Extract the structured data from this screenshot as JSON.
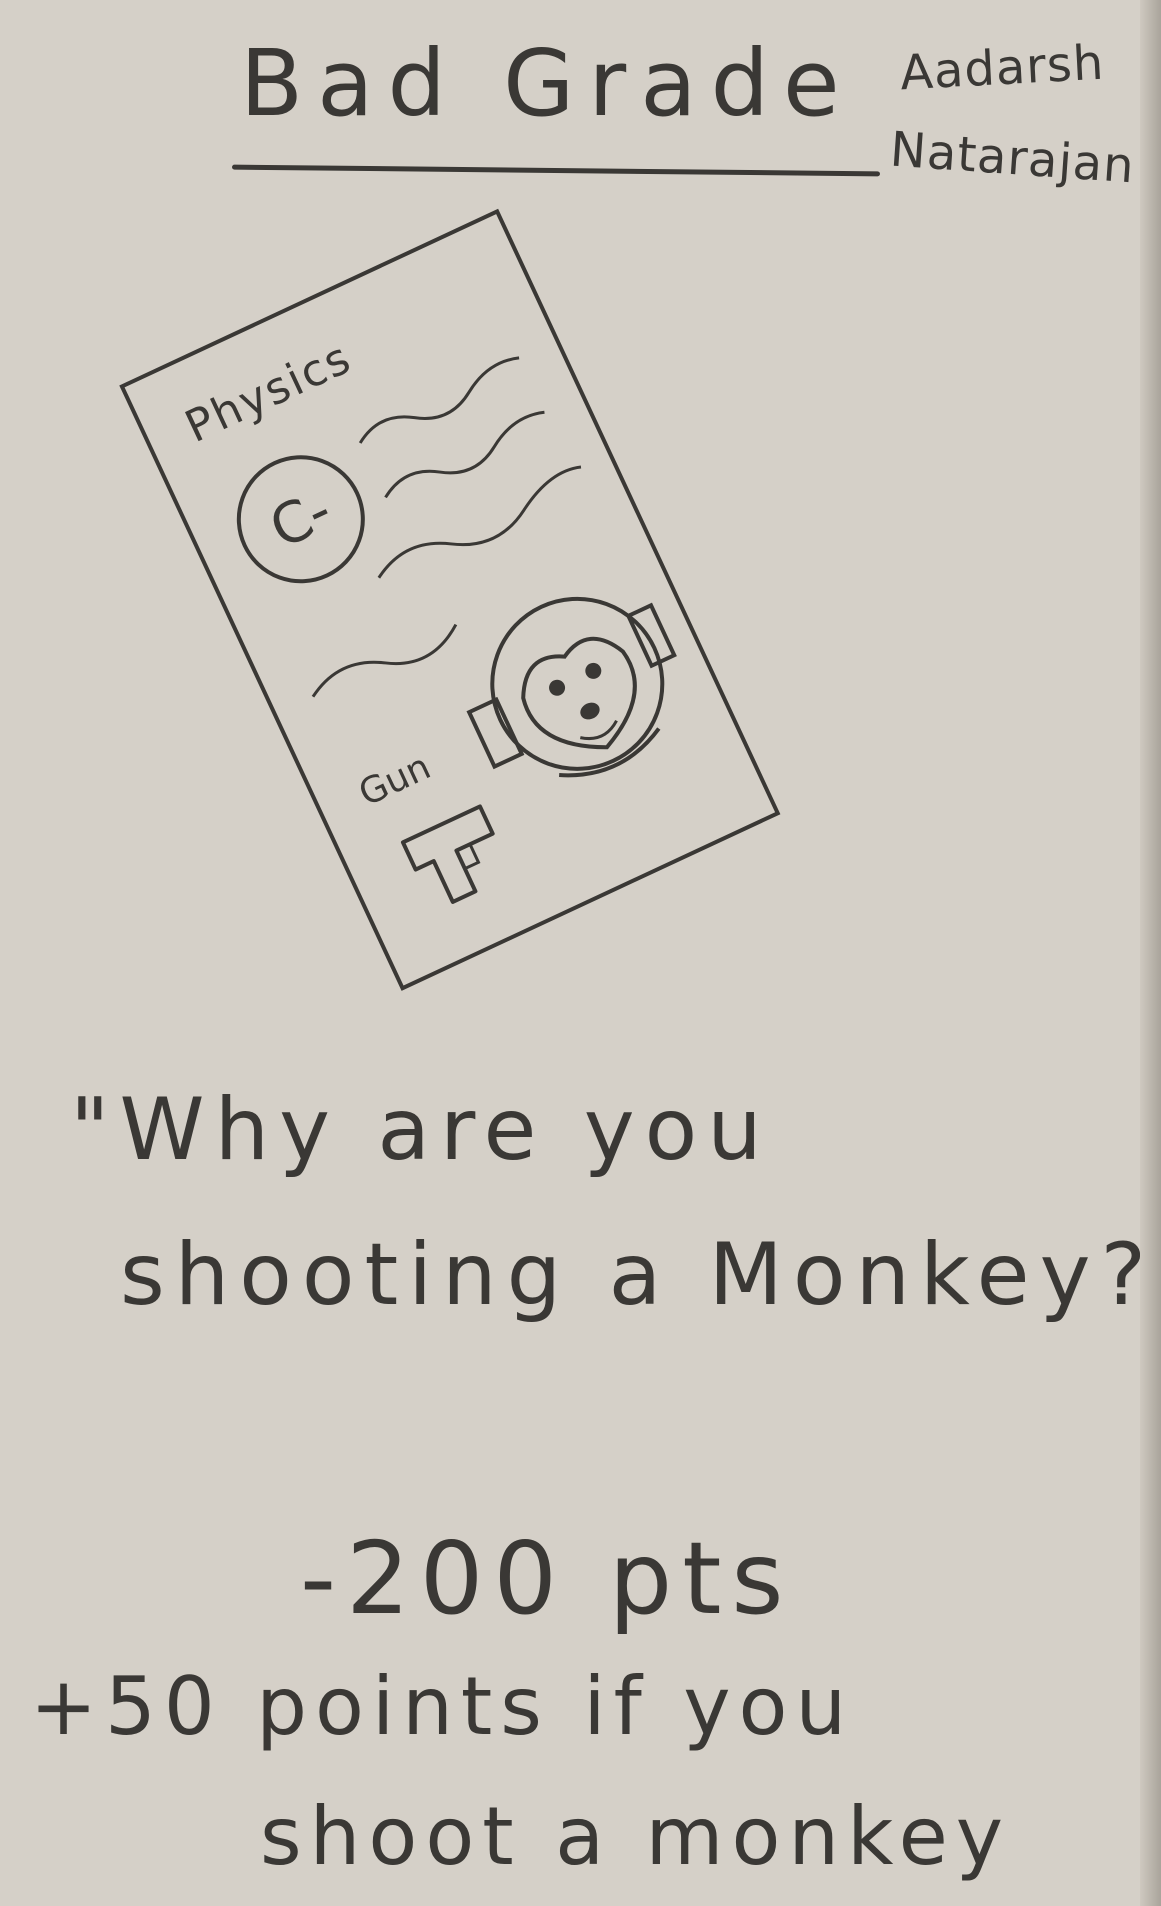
{
  "card": {
    "title": "Bad Grade",
    "author_first": "Aadarsh",
    "author_last": "Natarajan",
    "report": {
      "subject": "Physics",
      "grade": "C-",
      "second_label": "Gun",
      "icons": [
        "gun-icon",
        "monkey-icon"
      ]
    },
    "quote_line1": "\"Why are you",
    "quote_line2": "shooting a Monkey?\"",
    "penalty": "-200 pts",
    "bonus_line1": "+50 points if you",
    "bonus_line2": "shoot a monkey"
  },
  "colors": {
    "paper": "#d5d0c8",
    "pencil": "#3a3835"
  }
}
